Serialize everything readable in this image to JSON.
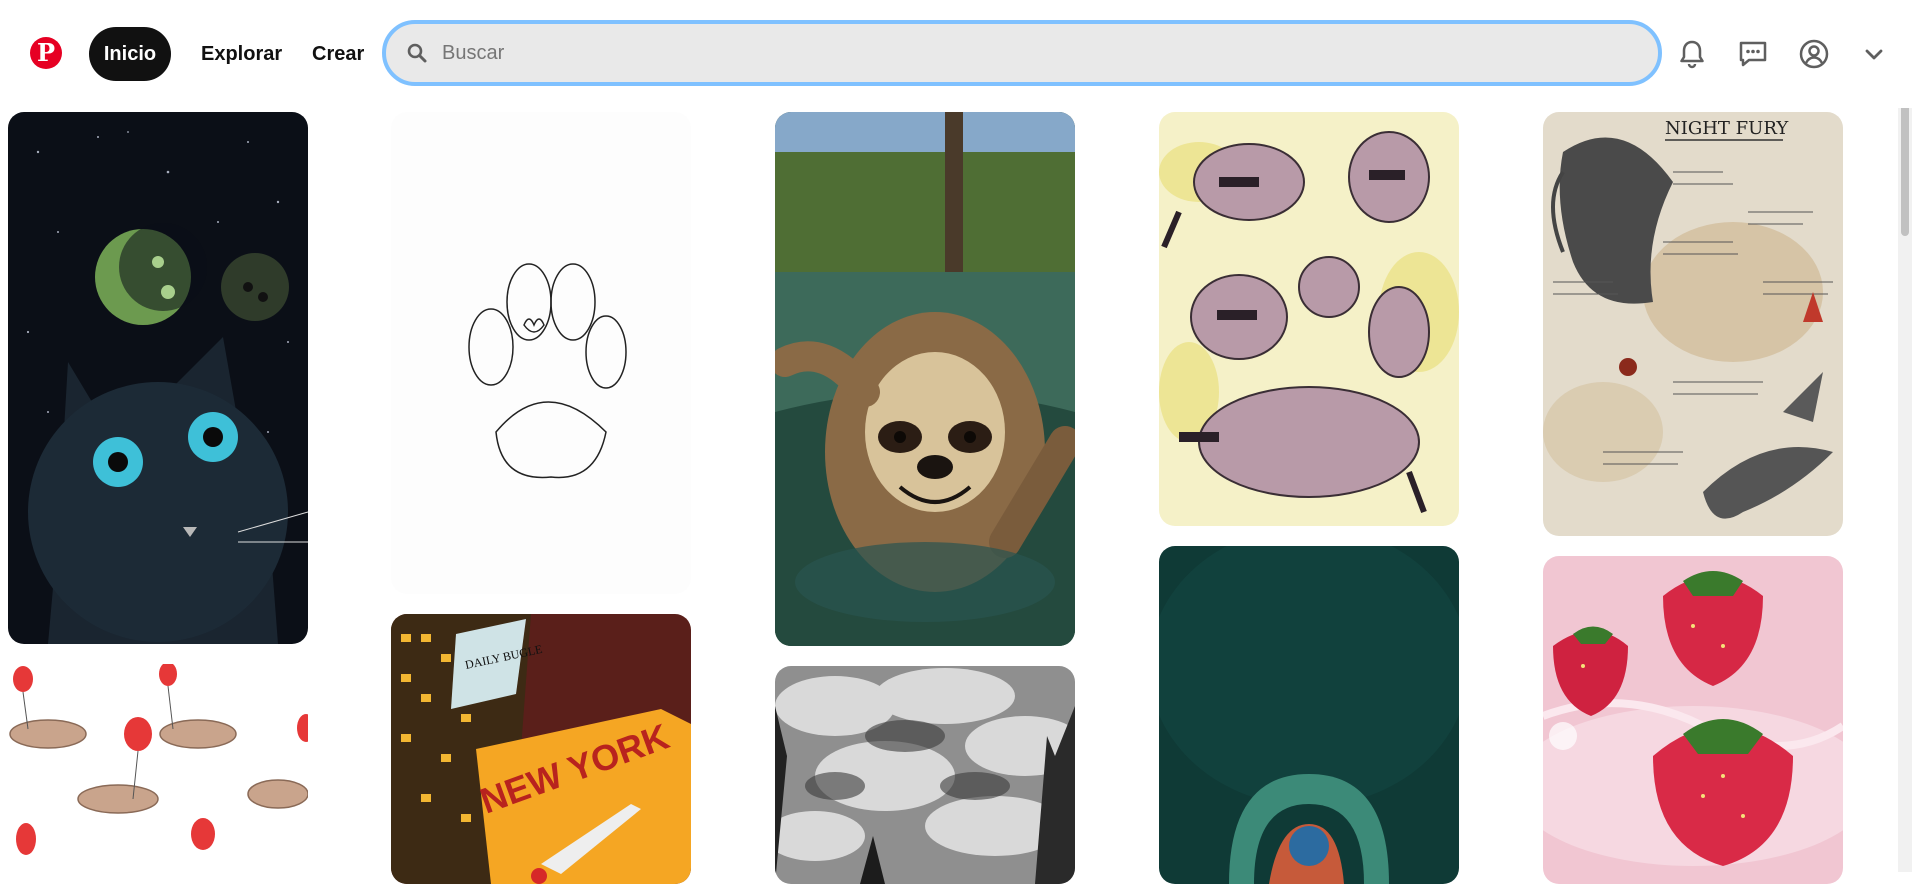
{
  "header": {
    "logo_letter": "P",
    "nav": {
      "home": "Inicio",
      "explore": "Explorar",
      "create": "Crear"
    },
    "search": {
      "placeholder": "Buscar",
      "value": ""
    },
    "icons": [
      "search-icon",
      "bell-icon",
      "chat-icon",
      "profile-icon",
      "chevron-down-icon"
    ]
  },
  "pins": [
    {
      "name": "pin-black-cat-moons",
      "desc": "Black cat under green moons"
    },
    {
      "name": "pin-dachshund-balloons",
      "desc": "Dachshunds with red balloons pattern"
    },
    {
      "name": "pin-paw-sketch",
      "desc": "Paw print line sketch"
    },
    {
      "name": "pin-new-york-poster",
      "desc": "New York poster with plane"
    },
    {
      "name": "pin-sloth-river",
      "desc": "Smiling sloth in river"
    },
    {
      "name": "pin-cloudy-sky",
      "desc": "Cloudy sky with spires"
    },
    {
      "name": "pin-raccoon-sketches",
      "desc": "Raccoon watercolor sketches"
    },
    {
      "name": "pin-teal-abstract",
      "desc": "Teal abstract painting"
    },
    {
      "name": "pin-night-fury-sheet",
      "desc": "Night Fury notebook page"
    },
    {
      "name": "pin-strawberries",
      "desc": "Strawberries in pink water"
    }
  ],
  "night_fury_title": "NIGHT FURY",
  "daily_bugle_text": "DAILY BUGLE",
  "new_york_text": "NEW YORK"
}
